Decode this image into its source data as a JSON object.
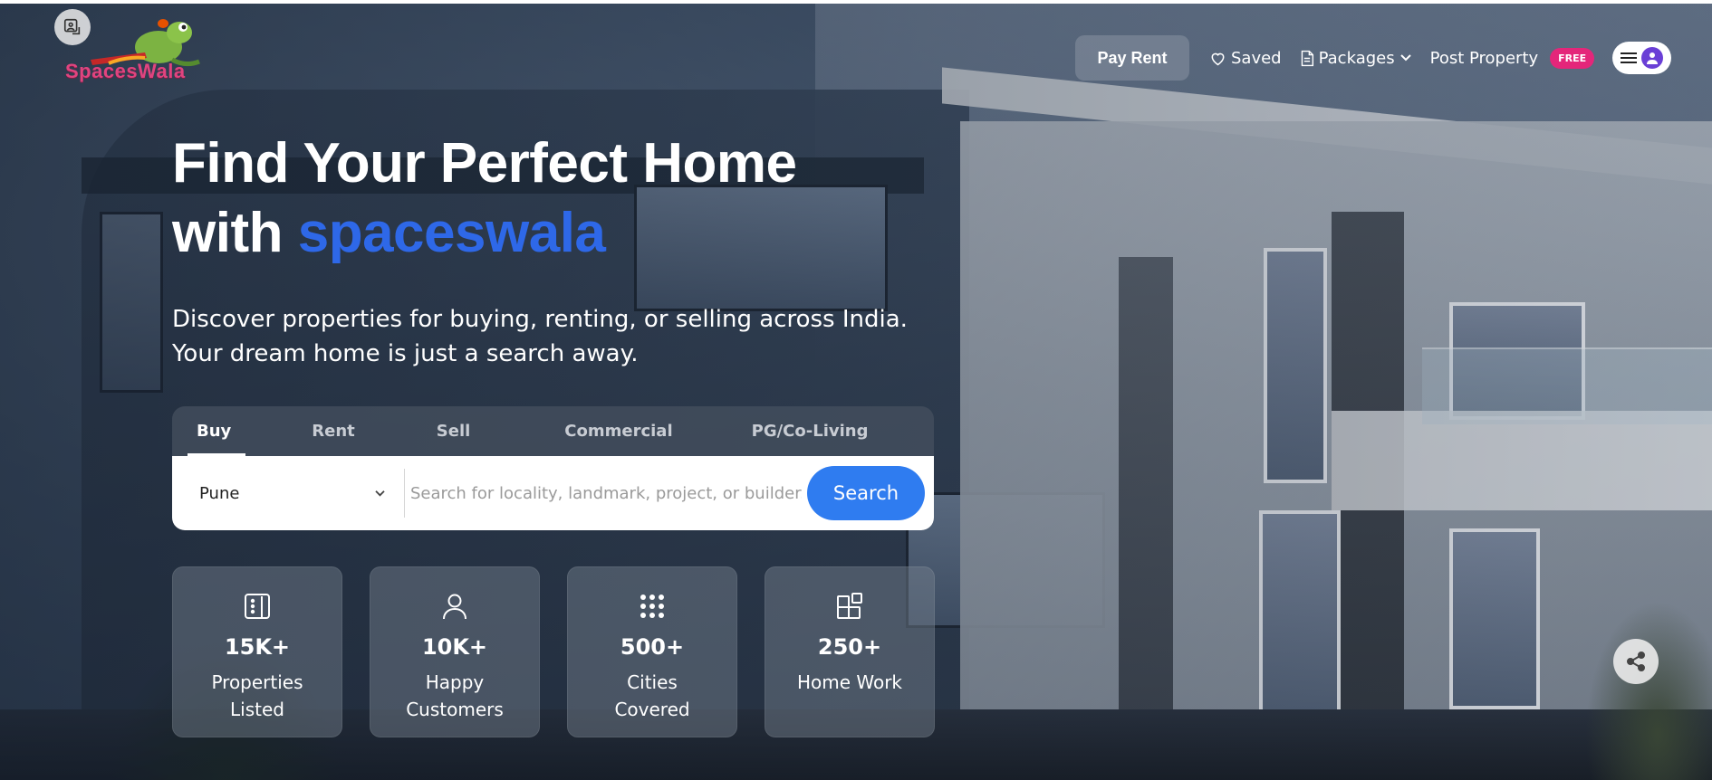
{
  "header": {
    "logo_text": "SpacesWala",
    "nav": {
      "pay_rent": "Pay Rent",
      "saved": "Saved",
      "packages": "Packages",
      "post_property": "Post Property",
      "free_badge": "FREE"
    }
  },
  "hero": {
    "headline_line1": "Find Your Perfect Home",
    "headline_with": "with",
    "headline_brand": "spaceswala",
    "subtext": "Discover properties for buying, renting, or selling across India. Your dream home is just a search away."
  },
  "search": {
    "tabs": [
      {
        "label": "Buy",
        "active": true
      },
      {
        "label": "Rent",
        "active": false
      },
      {
        "label": "Sell",
        "active": false
      },
      {
        "label": "Commercial",
        "active": false
      },
      {
        "label": "PG/Co-Living",
        "active": false
      }
    ],
    "city": "Pune",
    "placeholder": "Search for locality, landmark, project, or builder.",
    "button_label": "Search"
  },
  "stats": [
    {
      "value": "15K+",
      "label": "Properties Listed",
      "icon": "building-icon"
    },
    {
      "value": "10K+",
      "label": "Happy Customers",
      "icon": "user-icon"
    },
    {
      "value": "500+",
      "label": "Cities Covered",
      "icon": "grid-dots-icon"
    },
    {
      "value": "250+",
      "label": "Home Work",
      "icon": "widgets-icon"
    }
  ],
  "colors": {
    "accent_blue": "#2e68e8",
    "search_button": "#2f7cf0",
    "free_badge": "#e4267a",
    "logo_pink": "#e0447f"
  }
}
